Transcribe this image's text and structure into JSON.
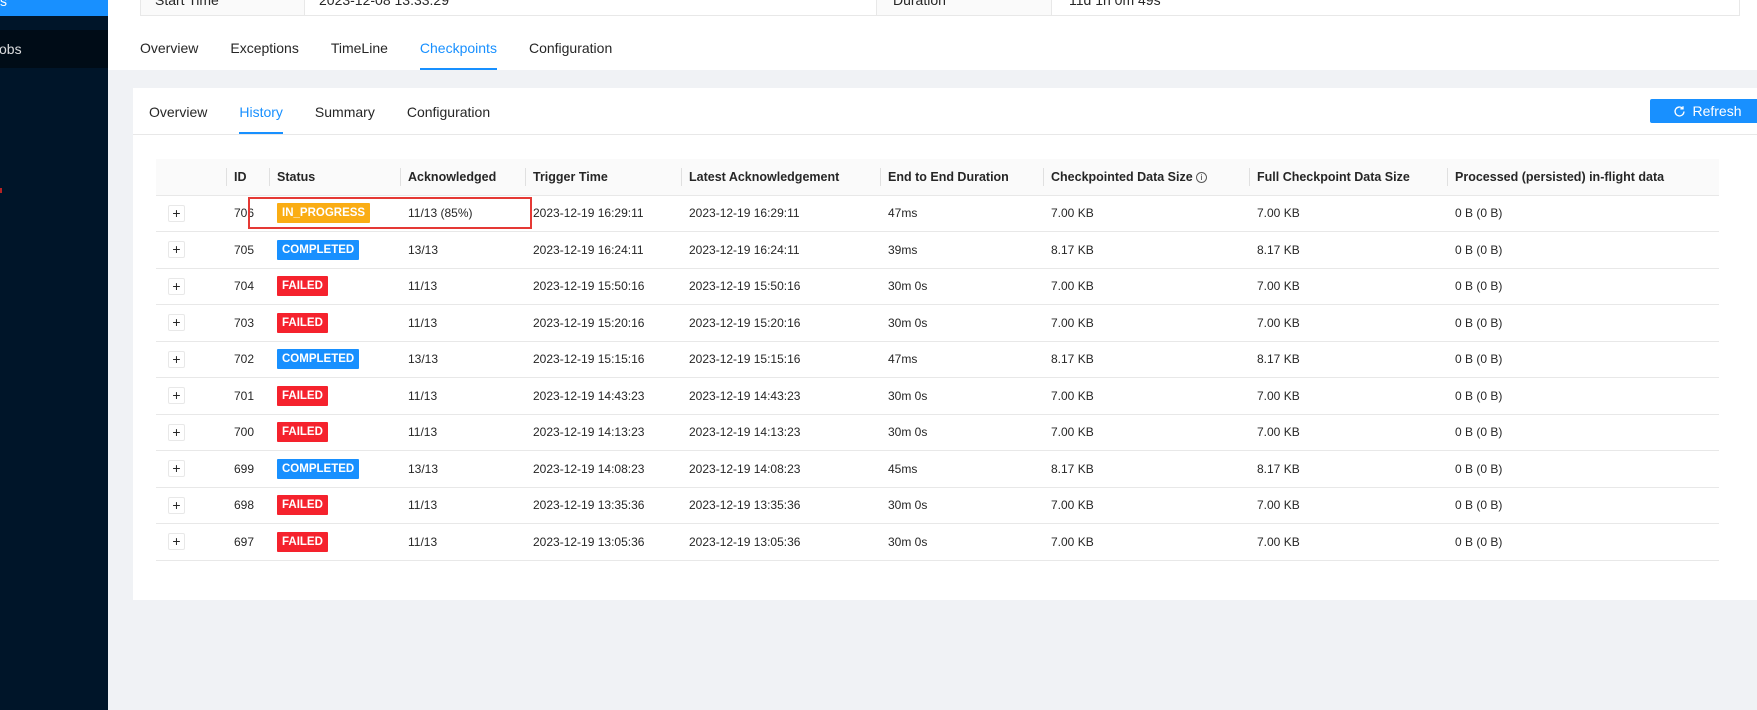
{
  "sidebar": {
    "active_item_label": "s",
    "item_label": "Jobs"
  },
  "job_info": {
    "start_time_label": "Start Time",
    "start_time_value": "2023-12-08 13:33:29",
    "duration_label": "Duration",
    "duration_value": "11d 1h 0m 49s"
  },
  "main_tabs": [
    {
      "label": "Overview",
      "active": false
    },
    {
      "label": "Exceptions",
      "active": false
    },
    {
      "label": "TimeLine",
      "active": false
    },
    {
      "label": "Checkpoints",
      "active": true
    },
    {
      "label": "Configuration",
      "active": false
    }
  ],
  "sub_tabs": [
    {
      "label": "Overview",
      "active": false
    },
    {
      "label": "History",
      "active": true
    },
    {
      "label": "Summary",
      "active": false
    },
    {
      "label": "Configuration",
      "active": false
    }
  ],
  "refresh_label": "Refresh",
  "table": {
    "columns": [
      "",
      "ID",
      "Status",
      "Acknowledged",
      "Trigger Time",
      "Latest Acknowledgement",
      "End to End Duration",
      "Checkpointed Data Size",
      "Full Checkpoint Data Size",
      "Processed (persisted) in-flight data"
    ],
    "expand_symbol": "+",
    "info_symbol": "i",
    "rows": [
      {
        "id": "706",
        "status": "IN_PROGRESS",
        "status_class": "in_progress",
        "ack": "11/13 (85%)",
        "trigger": "2023-12-19 16:29:11",
        "latest_ack": "2023-12-19 16:29:11",
        "duration": "47ms",
        "cp_size": "7.00 KB",
        "full_size": "7.00 KB",
        "inflight": "0 B (0 B)"
      },
      {
        "id": "705",
        "status": "COMPLETED",
        "status_class": "completed",
        "ack": "13/13",
        "trigger": "2023-12-19 16:24:11",
        "latest_ack": "2023-12-19 16:24:11",
        "duration": "39ms",
        "cp_size": "8.17 KB",
        "full_size": "8.17 KB",
        "inflight": "0 B (0 B)"
      },
      {
        "id": "704",
        "status": "FAILED",
        "status_class": "failed",
        "ack": "11/13",
        "trigger": "2023-12-19 15:50:16",
        "latest_ack": "2023-12-19 15:50:16",
        "duration": "30m 0s",
        "cp_size": "7.00 KB",
        "full_size": "7.00 KB",
        "inflight": "0 B (0 B)"
      },
      {
        "id": "703",
        "status": "FAILED",
        "status_class": "failed",
        "ack": "11/13",
        "trigger": "2023-12-19 15:20:16",
        "latest_ack": "2023-12-19 15:20:16",
        "duration": "30m 0s",
        "cp_size": "7.00 KB",
        "full_size": "7.00 KB",
        "inflight": "0 B (0 B)"
      },
      {
        "id": "702",
        "status": "COMPLETED",
        "status_class": "completed",
        "ack": "13/13",
        "trigger": "2023-12-19 15:15:16",
        "latest_ack": "2023-12-19 15:15:16",
        "duration": "47ms",
        "cp_size": "8.17 KB",
        "full_size": "8.17 KB",
        "inflight": "0 B (0 B)"
      },
      {
        "id": "701",
        "status": "FAILED",
        "status_class": "failed",
        "ack": "11/13",
        "trigger": "2023-12-19 14:43:23",
        "latest_ack": "2023-12-19 14:43:23",
        "duration": "30m 0s",
        "cp_size": "7.00 KB",
        "full_size": "7.00 KB",
        "inflight": "0 B (0 B)"
      },
      {
        "id": "700",
        "status": "FAILED",
        "status_class": "failed",
        "ack": "11/13",
        "trigger": "2023-12-19 14:13:23",
        "latest_ack": "2023-12-19 14:13:23",
        "duration": "30m 0s",
        "cp_size": "7.00 KB",
        "full_size": "7.00 KB",
        "inflight": "0 B (0 B)"
      },
      {
        "id": "699",
        "status": "COMPLETED",
        "status_class": "completed",
        "ack": "13/13",
        "trigger": "2023-12-19 14:08:23",
        "latest_ack": "2023-12-19 14:08:23",
        "duration": "45ms",
        "cp_size": "8.17 KB",
        "full_size": "8.17 KB",
        "inflight": "0 B (0 B)"
      },
      {
        "id": "698",
        "status": "FAILED",
        "status_class": "failed",
        "ack": "11/13",
        "trigger": "2023-12-19 13:35:36",
        "latest_ack": "2023-12-19 13:35:36",
        "duration": "30m 0s",
        "cp_size": "7.00 KB",
        "full_size": "7.00 KB",
        "inflight": "0 B (0 B)"
      },
      {
        "id": "697",
        "status": "FAILED",
        "status_class": "failed",
        "ack": "11/13",
        "trigger": "2023-12-19 13:05:36",
        "latest_ack": "2023-12-19 13:05:36",
        "duration": "30m 0s",
        "cp_size": "7.00 KB",
        "full_size": "7.00 KB",
        "inflight": "0 B (0 B)"
      }
    ]
  },
  "colors": {
    "primary": "#1890ff",
    "in_progress": "#faad14",
    "completed": "#1890ff",
    "failed": "#f5222d",
    "sidebar_bg": "#001529",
    "highlight": "#e53935"
  }
}
